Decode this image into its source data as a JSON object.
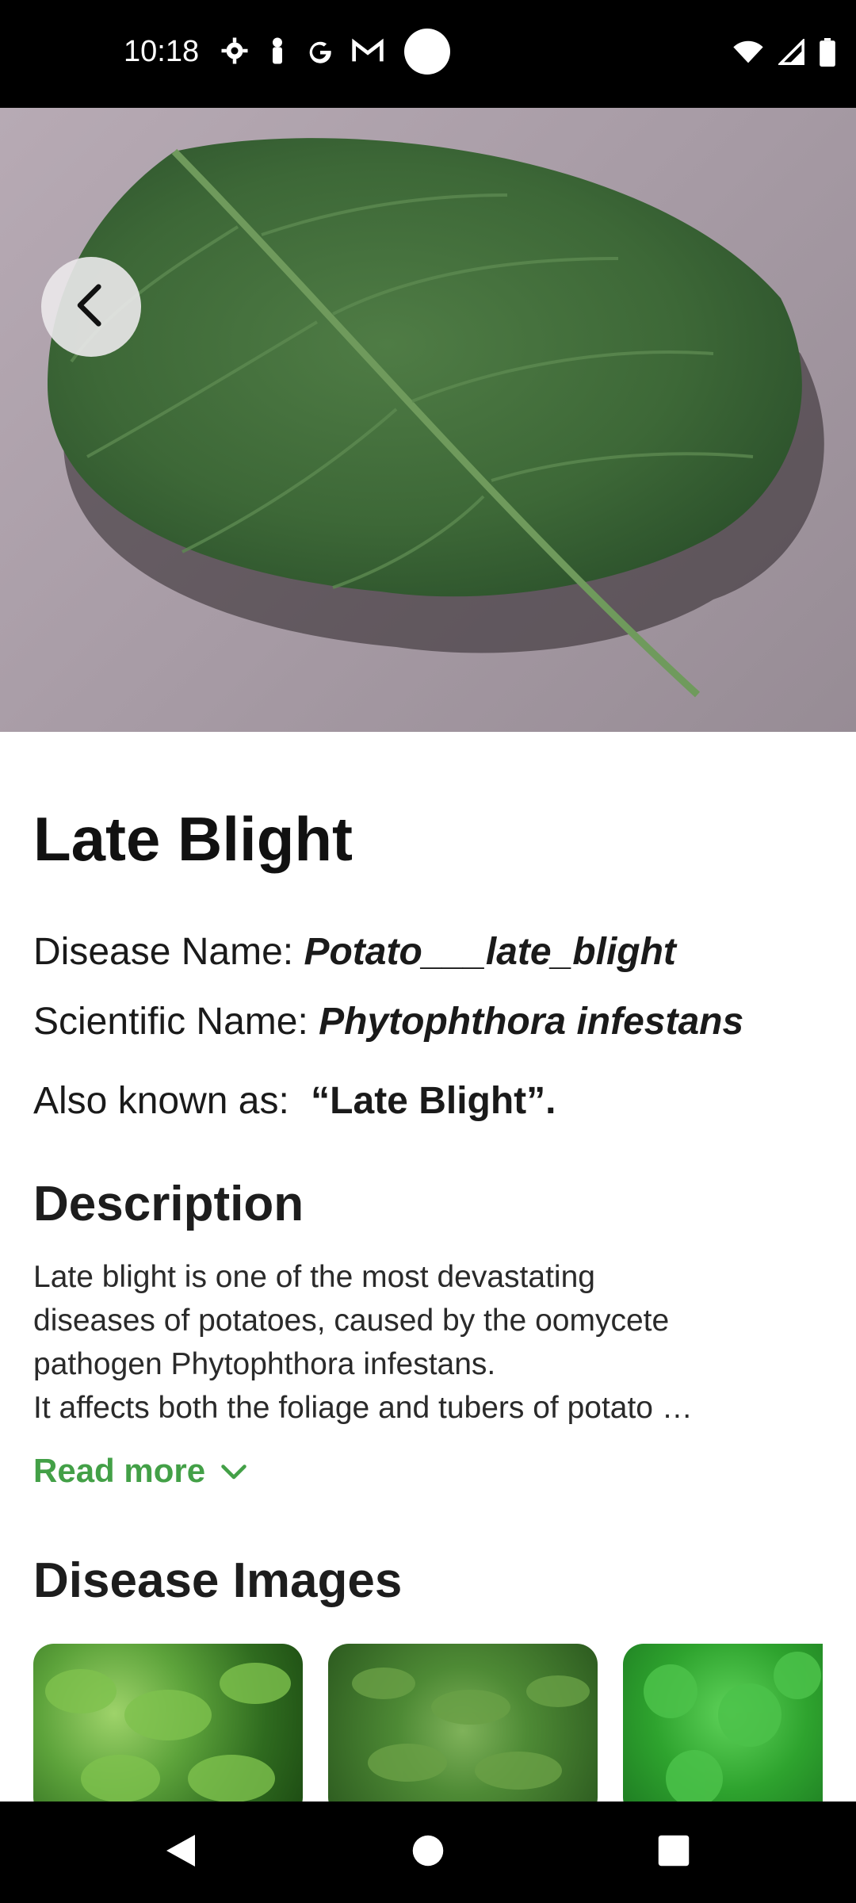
{
  "status_bar": {
    "time": "10:18",
    "left_icons": [
      "gear-icon",
      "person-icon",
      "google-icon",
      "gmail-icon"
    ],
    "right_icons": [
      "wifi-icon",
      "signal-icon",
      "battery-icon"
    ]
  },
  "hero": {
    "image": "potato-leaf-image",
    "back_icon": "chevron-left-icon"
  },
  "disease": {
    "title": "Late Blight",
    "disease_name_label": "Disease Name:",
    "disease_name_value": "Potato___late_blight",
    "scientific_name_label": "Scientific Name:",
    "scientific_name_value": "Phytophthora infestans",
    "also_known_label": "Also known as:",
    "also_known_value": "“Late Blight”."
  },
  "description": {
    "heading": "Description",
    "lines": [
      "Late blight is one of the most devastating",
      "diseases of potatoes, caused by the oomycete",
      "pathogen Phytophthora infestans.",
      "It affects both the foliage and tubers of potato …"
    ],
    "read_more_label": "Read more",
    "read_more_icon": "chevron-down-icon",
    "accent_color": "#43a047"
  },
  "images": {
    "heading": "Disease Images",
    "thumbnails": [
      "leaf-thumbnail-1",
      "leaf-thumbnail-2",
      "leaf-thumbnail-3"
    ]
  },
  "nav_bar": {
    "buttons": [
      "back-triangle-icon",
      "home-circle-icon",
      "recents-square-icon"
    ]
  }
}
